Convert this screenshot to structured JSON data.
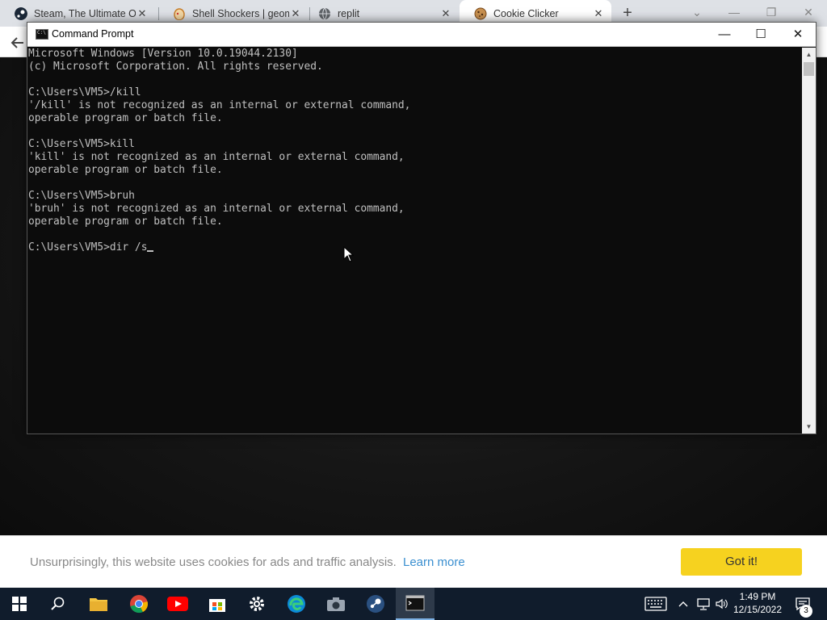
{
  "browser": {
    "tabs": [
      {
        "title": "Steam, The Ultimate Or",
        "icon": "steam-icon",
        "color": "#1b2838"
      },
      {
        "title": "Shell Shockers | geome",
        "icon": "shellshockers-icon",
        "color": "#e6a04a"
      },
      {
        "title": "replit",
        "icon": "globe-icon",
        "color": "#5f6368"
      },
      {
        "title": "Cookie Clicker",
        "icon": "cookie-icon",
        "color": "#8a5a2b"
      }
    ],
    "close_glyph": "✕",
    "new_tab_glyph": "+"
  },
  "cmd": {
    "title": "Command Prompt",
    "lines": [
      "Microsoft Windows [Version 10.0.19044.2130]",
      "(c) Microsoft Corporation. All rights reserved.",
      "",
      "C:\\Users\\VM5>/kill",
      "'/kill' is not recognized as an internal or external command,",
      "operable program or batch file.",
      "",
      "C:\\Users\\VM5>kill",
      "'kill' is not recognized as an internal or external command,",
      "operable program or batch file.",
      "",
      "C:\\Users\\VM5>bruh",
      "'bruh' is not recognized as an internal or external command,",
      "operable program or batch file.",
      "",
      "C:\\Users\\VM5>dir /s"
    ]
  },
  "cookie_banner": {
    "text": "Unsurprisingly, this website uses cookies for ads and traffic analysis.",
    "learn_more": "Learn more",
    "button": "Got it!"
  },
  "taskbar": {
    "apps": [
      "start-icon",
      "search-icon",
      "file-explorer-icon",
      "chrome-icon",
      "youtube-icon",
      "microsoft-store-icon",
      "settings-icon",
      "edge-icon",
      "camera-icon",
      "steam-icon",
      "command-prompt-icon"
    ],
    "time": "1:49 PM",
    "date": "12/15/2022",
    "notification_count": "3"
  }
}
